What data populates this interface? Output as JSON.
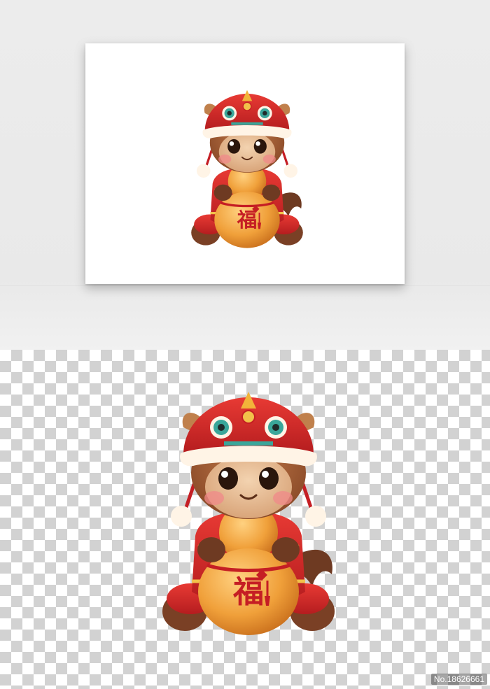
{
  "artwork": {
    "subject": "lucky-horse-mascot-with-lion-dance-hat",
    "fu_character": "福",
    "colors": {
      "hat_red": "#d8282a",
      "fur_brown": "#9a5a35",
      "gourd_orange": "#f0a03a",
      "trim_cream": "#fff4e6",
      "checker_gray": "#d2d2d2"
    }
  },
  "watermark": {
    "text": "No.18626661"
  }
}
